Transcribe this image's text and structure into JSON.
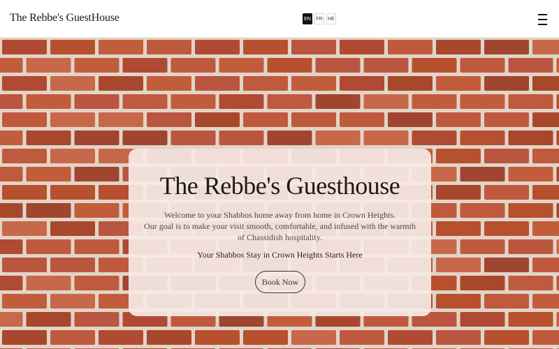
{
  "header": {
    "brand": "The Rebbe's GuestHouse",
    "languages": [
      "EN",
      "FR",
      "HE"
    ],
    "active_language": "EN",
    "menu_icon": "hamburger-menu-icon"
  },
  "hero": {
    "background": "brick-wall",
    "title": "The Rebbe's Guesthouse",
    "description_line1": "Welcome to your Shabbos home away from home in Crown Heights.",
    "description_line2": "Our goal is to make your visit smooth, comfortable, and infused with the warmth of Chassidish hospitality.",
    "tagline": "Your Shabbos Stay in Crown Heights Starts Here",
    "cta_label": "Book Now"
  },
  "colors": {
    "brick": "#b9553a",
    "mortar": "#e2d4c6",
    "card_bg": "#f6eae6",
    "text_dark": "#1b1b1b"
  }
}
